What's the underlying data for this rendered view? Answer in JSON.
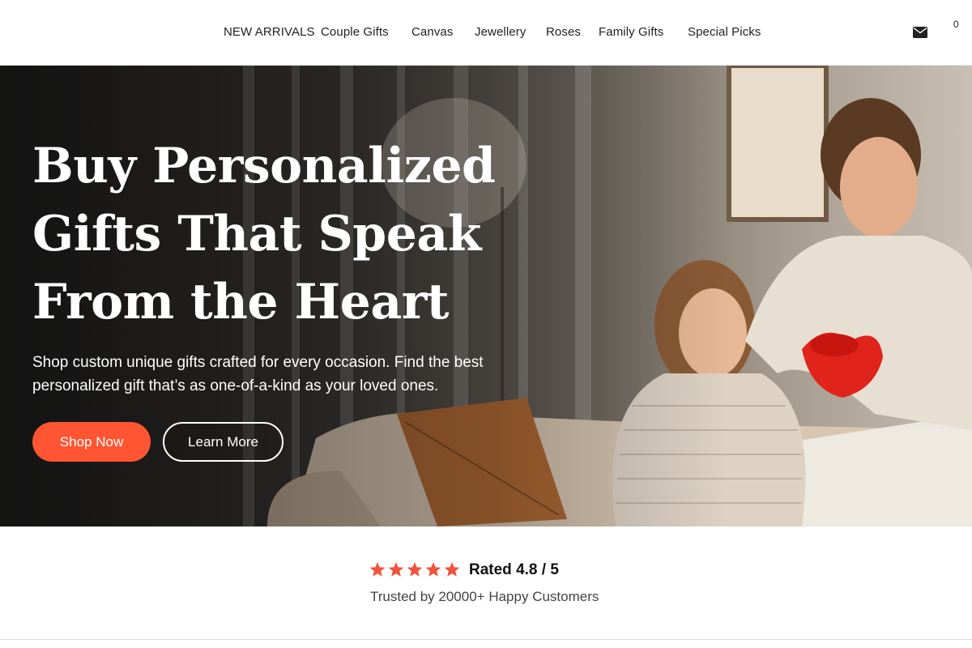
{
  "nav": {
    "items": [
      {
        "label": "NEW ARRIVALS"
      },
      {
        "label": "Couple Gifts"
      },
      {
        "label": "Canvas"
      },
      {
        "label": "Jewellery"
      },
      {
        "label": "Roses"
      },
      {
        "label": "Family Gifts"
      },
      {
        "label": "Special Picks"
      }
    ],
    "mail_icon": "envelope-icon",
    "cart_count": "0"
  },
  "hero": {
    "title": "Buy Personalized Gifts That Speak From the Heart",
    "subtitle": "Shop custom unique gifts crafted for every occasion. Find the best personalized gift that’s as one-of-a-kind as your loved ones.",
    "primary_button": "Shop Now",
    "secondary_button": "Learn More",
    "image": "photo-couple-exchanging-red-heart-gift-box-on-sofa"
  },
  "rating": {
    "stars": 5,
    "rated_label": "Rated 4.8 / 5",
    "trust_label": "Trusted by 20000+ Happy Customers",
    "star_icon": "star-icon"
  },
  "colors": {
    "accent": "#ff5533",
    "star": "#f0533c",
    "text": "#222222"
  }
}
